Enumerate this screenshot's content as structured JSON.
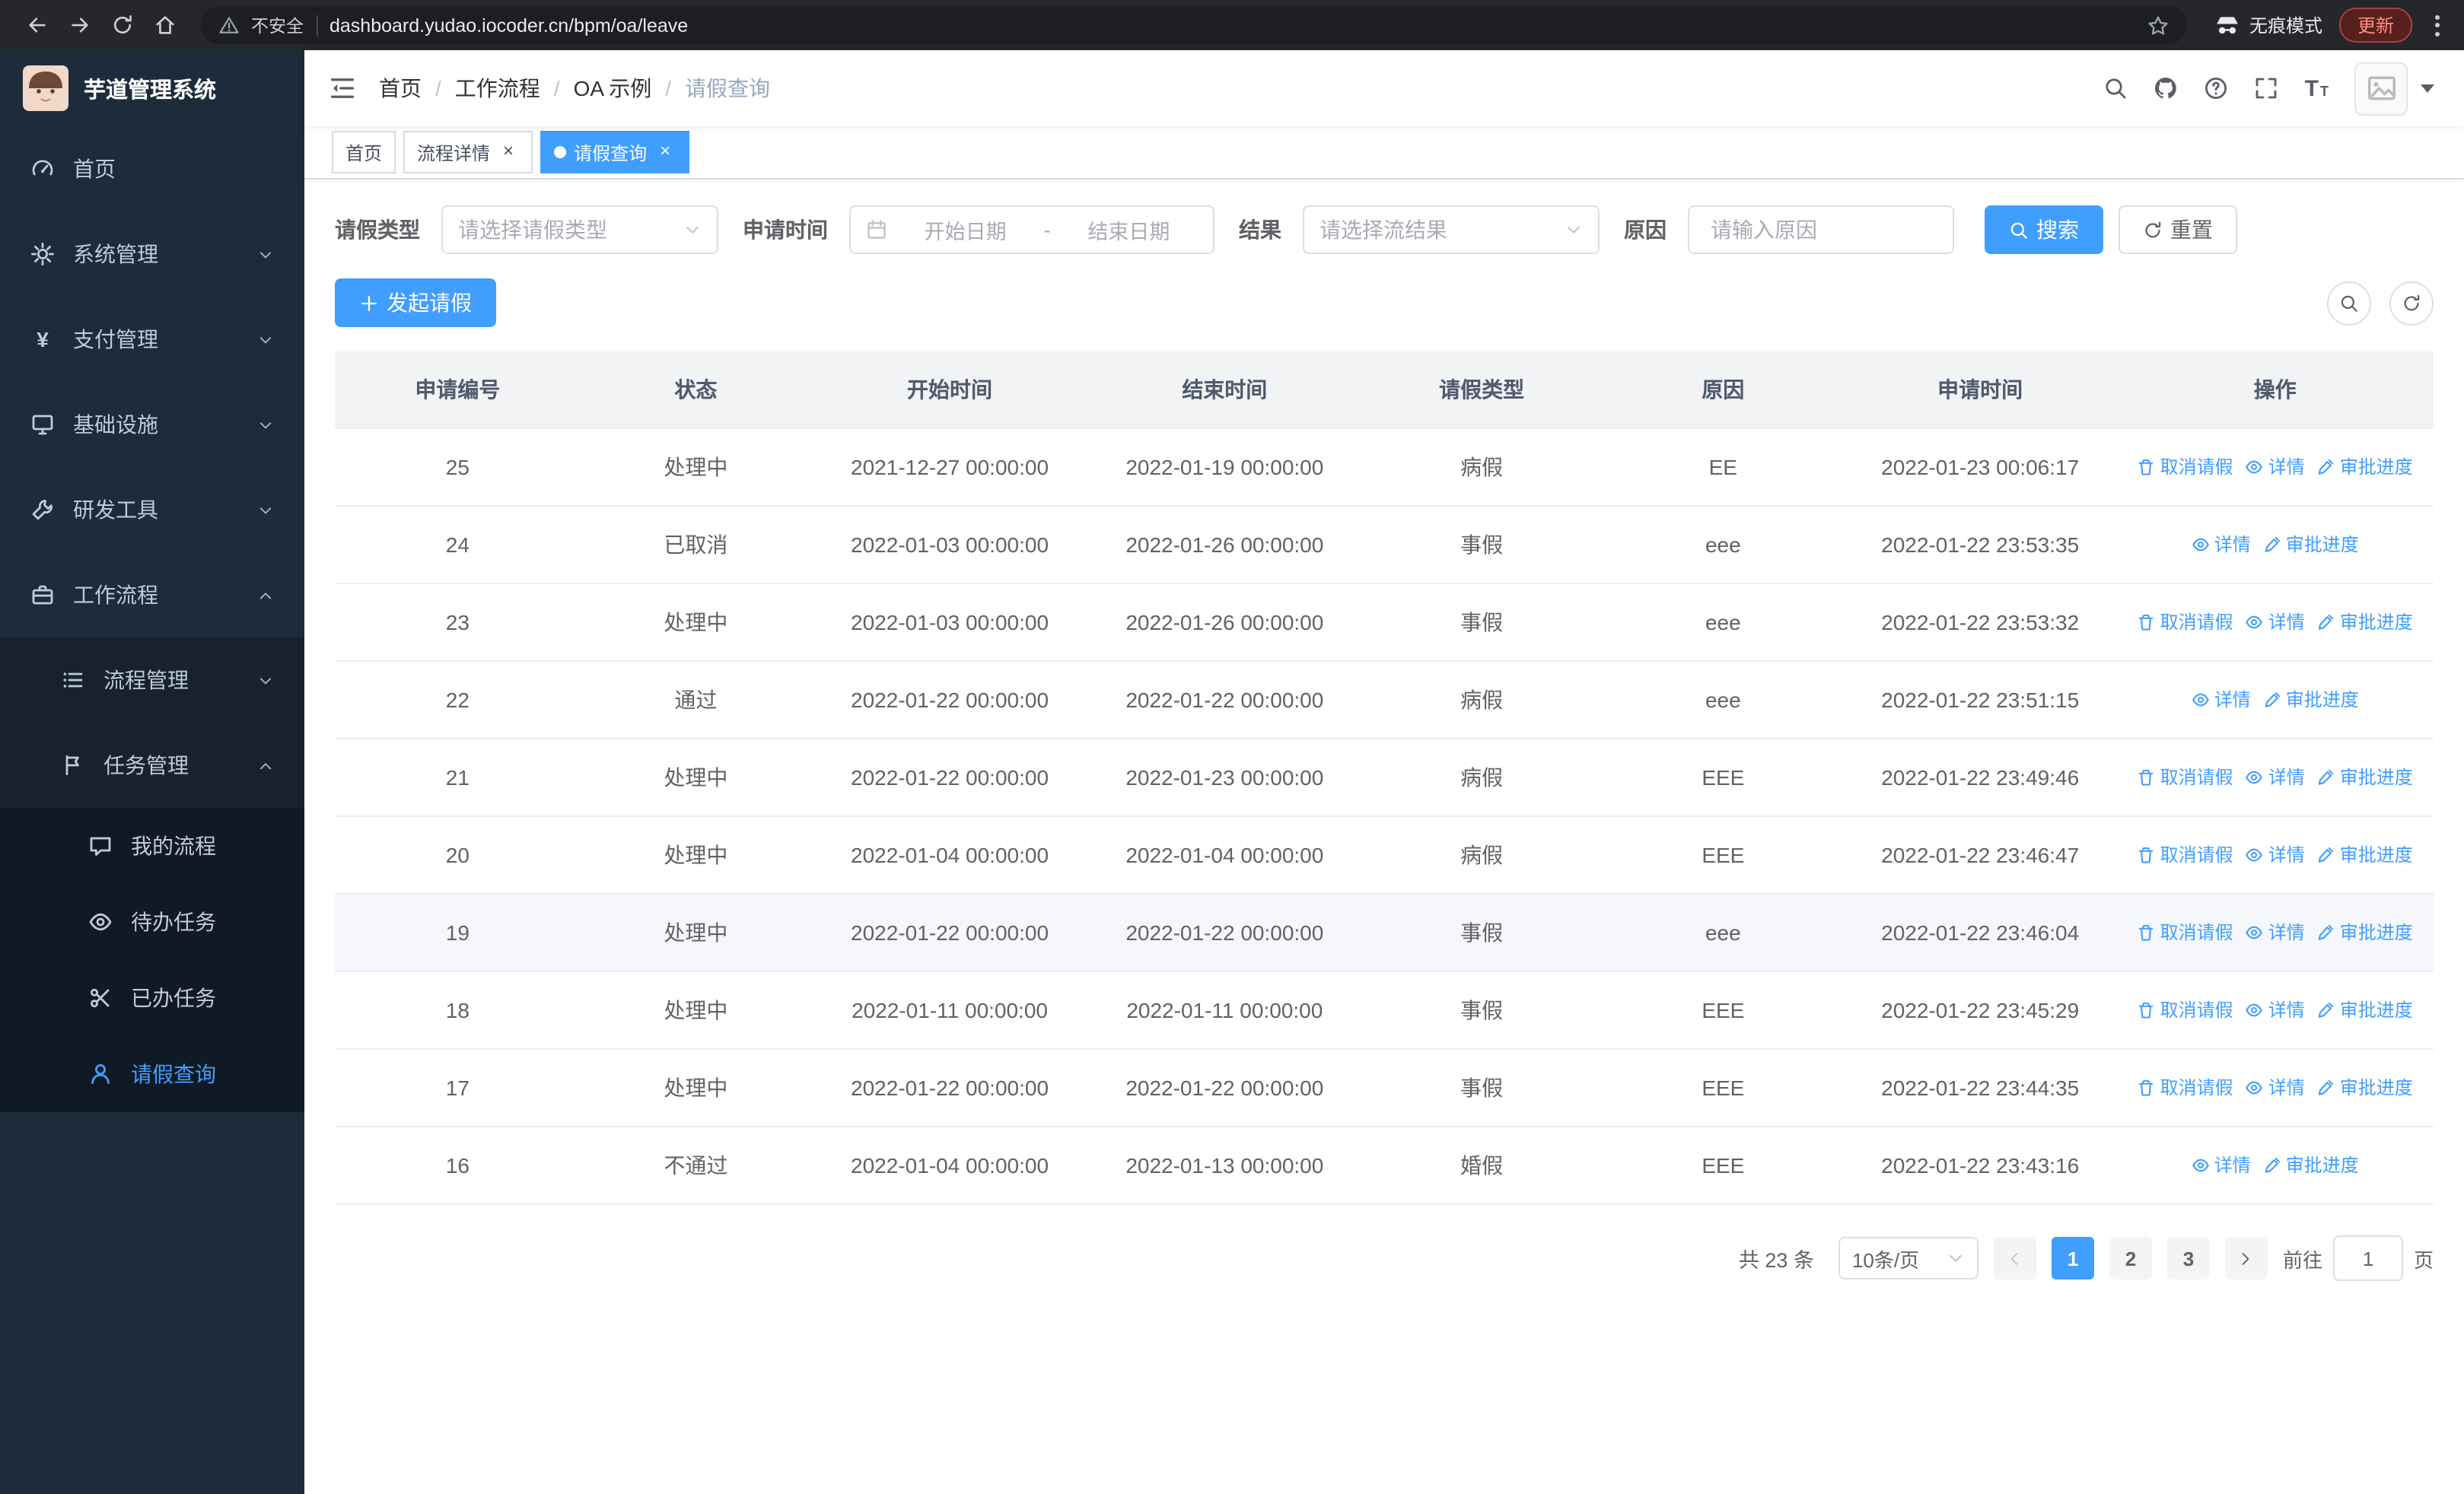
{
  "colors": {
    "primary": "#409eff",
    "sidebar_bg": "#1d2b3a",
    "chrome_bg": "#26272b"
  },
  "browser": {
    "warning": "不安全",
    "url": "dashboard.yudao.iocoder.cn/bpm/oa/leave",
    "incognito": "无痕模式",
    "update": "更新"
  },
  "logo": {
    "title": "芋道管理系统"
  },
  "sidebar": [
    {
      "label": "首页",
      "icon": "dashboard-icon",
      "level": 1
    },
    {
      "label": "系统管理",
      "icon": "gear-icon",
      "level": 1,
      "arrow": "down"
    },
    {
      "label": "支付管理",
      "icon": "yen-icon",
      "level": 1,
      "arrow": "down"
    },
    {
      "label": "基础设施",
      "icon": "infra-icon",
      "level": 1,
      "arrow": "down"
    },
    {
      "label": "研发工具",
      "icon": "tools-icon",
      "level": 1,
      "arrow": "down"
    },
    {
      "label": "工作流程",
      "icon": "workflow-icon",
      "level": 1,
      "arrow": "up",
      "open": true
    },
    {
      "label": "流程管理",
      "icon": "process-icon",
      "level": 2,
      "arrow": "down"
    },
    {
      "label": "任务管理",
      "icon": "task-icon",
      "level": 2,
      "arrow": "up",
      "open": true
    },
    {
      "label": "我的流程",
      "icon": "chat-icon",
      "level": 3
    },
    {
      "label": "待办任务",
      "icon": "eye-icon",
      "level": 3
    },
    {
      "label": "已办任务",
      "icon": "scissors-icon",
      "level": 3
    },
    {
      "label": "请假查询",
      "icon": "user-icon",
      "level": 3,
      "active": true
    }
  ],
  "breadcrumb": [
    "首页",
    "工作流程",
    "OA 示例",
    "请假查询"
  ],
  "breadcrumb_separator": "/",
  "tabs": [
    {
      "label": "首页",
      "closable": false,
      "active": false
    },
    {
      "label": "流程详情",
      "closable": true,
      "active": false
    },
    {
      "label": "请假查询",
      "closable": true,
      "active": true
    }
  ],
  "filters": {
    "leave_type_label": "请假类型",
    "leave_type_placeholder": "请选择请假类型",
    "apply_time_label": "申请时间",
    "start_placeholder": "开始日期",
    "range_separator": "-",
    "end_placeholder": "结束日期",
    "result_label": "结果",
    "result_placeholder": "请选择流结果",
    "reason_label": "原因",
    "reason_placeholder": "请输入原因",
    "search_button": "搜索",
    "reset_button": "重置"
  },
  "toolbar": {
    "create_button": "发起请假"
  },
  "table": {
    "headers": [
      "申请编号",
      "状态",
      "开始时间",
      "结束时间",
      "请假类型",
      "原因",
      "申请时间",
      "操作"
    ],
    "op_defs": {
      "cancel": {
        "label": "取消请假",
        "icon": "delete-icon"
      },
      "detail": {
        "label": "详情",
        "icon": "view-icon"
      },
      "progress": {
        "label": "审批进度",
        "icon": "edit-icon"
      }
    },
    "rows": [
      {
        "id": "25",
        "status": "处理中",
        "start": "2021-12-27 00:00:00",
        "end": "2022-01-19 00:00:00",
        "type": "病假",
        "reason": "EE",
        "applied": "2022-01-23 00:06:17",
        "ops": [
          "cancel",
          "detail",
          "progress"
        ]
      },
      {
        "id": "24",
        "status": "已取消",
        "start": "2022-01-03 00:00:00",
        "end": "2022-01-26 00:00:00",
        "type": "事假",
        "reason": "eee",
        "applied": "2022-01-22 23:53:35",
        "ops": [
          "detail",
          "progress"
        ]
      },
      {
        "id": "23",
        "status": "处理中",
        "start": "2022-01-03 00:00:00",
        "end": "2022-01-26 00:00:00",
        "type": "事假",
        "reason": "eee",
        "applied": "2022-01-22 23:53:32",
        "ops": [
          "cancel",
          "detail",
          "progress"
        ]
      },
      {
        "id": "22",
        "status": "通过",
        "start": "2022-01-22 00:00:00",
        "end": "2022-01-22 00:00:00",
        "type": "病假",
        "reason": "eee",
        "applied": "2022-01-22 23:51:15",
        "ops": [
          "detail",
          "progress"
        ]
      },
      {
        "id": "21",
        "status": "处理中",
        "start": "2022-01-22 00:00:00",
        "end": "2022-01-23 00:00:00",
        "type": "病假",
        "reason": "EEE",
        "applied": "2022-01-22 23:49:46",
        "ops": [
          "cancel",
          "detail",
          "progress"
        ]
      },
      {
        "id": "20",
        "status": "处理中",
        "start": "2022-01-04 00:00:00",
        "end": "2022-01-04 00:00:00",
        "type": "病假",
        "reason": "EEE",
        "applied": "2022-01-22 23:46:47",
        "ops": [
          "cancel",
          "detail",
          "progress"
        ]
      },
      {
        "id": "19",
        "status": "处理中",
        "start": "2022-01-22 00:00:00",
        "end": "2022-01-22 00:00:00",
        "type": "事假",
        "reason": "eee",
        "applied": "2022-01-22 23:46:04",
        "ops": [
          "cancel",
          "detail",
          "progress"
        ],
        "highlighted": true
      },
      {
        "id": "18",
        "status": "处理中",
        "start": "2022-01-11 00:00:00",
        "end": "2022-01-11 00:00:00",
        "type": "事假",
        "reason": "EEE",
        "applied": "2022-01-22 23:45:29",
        "ops": [
          "cancel",
          "detail",
          "progress"
        ]
      },
      {
        "id": "17",
        "status": "处理中",
        "start": "2022-01-22 00:00:00",
        "end": "2022-01-22 00:00:00",
        "type": "事假",
        "reason": "EEE",
        "applied": "2022-01-22 23:44:35",
        "ops": [
          "cancel",
          "detail",
          "progress"
        ]
      },
      {
        "id": "16",
        "status": "不通过",
        "start": "2022-01-04 00:00:00",
        "end": "2022-01-13 00:00:00",
        "type": "婚假",
        "reason": "EEE",
        "applied": "2022-01-22 23:43:16",
        "ops": [
          "detail",
          "progress"
        ]
      }
    ]
  },
  "pagination": {
    "total": "共 23 条",
    "page_size": "10条/页",
    "pages": [
      "1",
      "2",
      "3"
    ],
    "active_page": "1",
    "goto_label": "前往",
    "goto_value": "1",
    "goto_suffix": "页"
  }
}
